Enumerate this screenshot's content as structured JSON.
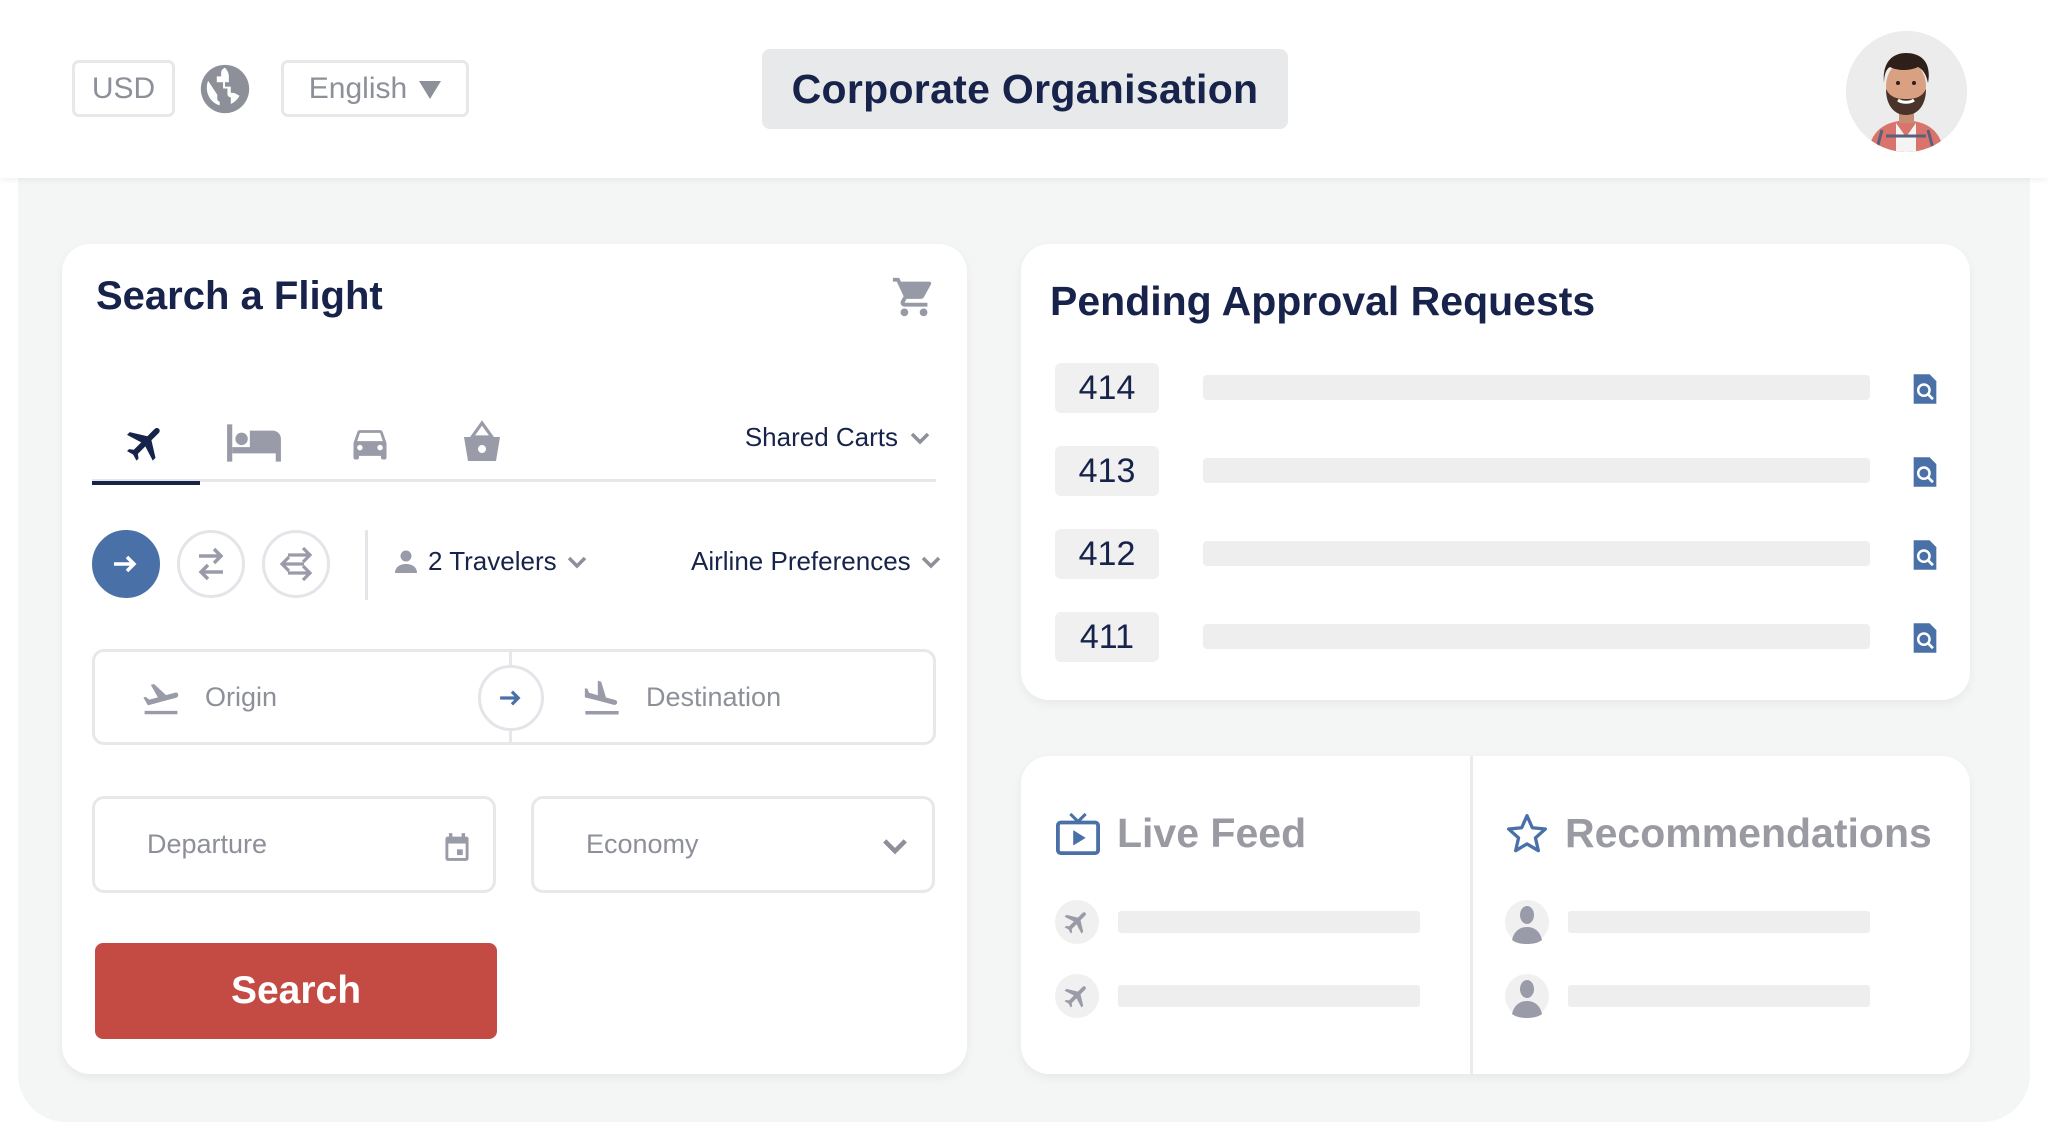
{
  "header": {
    "currency": "USD",
    "language": "English",
    "organisation": "Corporate Organisation",
    "avatar_alt": "User profile photo"
  },
  "search_flight": {
    "title": "Search a Flight",
    "tabs": [
      {
        "name": "flights",
        "icon": "airplane-icon",
        "active": true
      },
      {
        "name": "hotels",
        "icon": "bed-icon",
        "active": false
      },
      {
        "name": "cars",
        "icon": "car-icon",
        "active": false
      },
      {
        "name": "shop",
        "icon": "basket-icon",
        "active": false
      }
    ],
    "shared_carts": "Shared Carts",
    "trip_types": [
      {
        "name": "one-way",
        "active": true
      },
      {
        "name": "round-trip",
        "active": false
      },
      {
        "name": "multi-city",
        "active": false
      }
    ],
    "travelers": "2 Travelers",
    "airline_preferences": "Airline Preferences",
    "origin_placeholder": "Origin",
    "destination_placeholder": "Destination",
    "departure_placeholder": "Departure",
    "cabin_class": "Economy",
    "search_label": "Search"
  },
  "pending": {
    "title": "Pending Approval Requests",
    "requests": [
      {
        "id": "414"
      },
      {
        "id": "413"
      },
      {
        "id": "412"
      },
      {
        "id": "411"
      }
    ]
  },
  "live_feed": {
    "title": "Live Feed",
    "items": 2
  },
  "recommendations": {
    "title": "Recommendations",
    "items": 2
  },
  "colors": {
    "primary_navy": "#17234a",
    "accent_blue": "#4a70a8",
    "search_red": "#c44b44",
    "muted_grey": "#8e9099"
  }
}
